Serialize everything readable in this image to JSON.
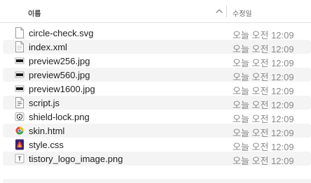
{
  "header": {
    "name_label": "이름",
    "date_label": "수정일"
  },
  "files": [
    {
      "name": "circle-check.svg",
      "date": "오늘 오전 12:09",
      "icon": "svg-file-icon"
    },
    {
      "name": "index.xml",
      "date": "오늘 오전 12:09",
      "icon": "text-file-icon"
    },
    {
      "name": "preview256.jpg",
      "date": "오늘 오전 12:09",
      "icon": "image-file-icon"
    },
    {
      "name": "preview560.jpg",
      "date": "오늘 오전 12:09",
      "icon": "image-file-icon"
    },
    {
      "name": "preview1600.jpg",
      "date": "오늘 오전 12:09",
      "icon": "image-file-icon"
    },
    {
      "name": "script.js",
      "date": "오늘 오전 12:09",
      "icon": "script-file-icon"
    },
    {
      "name": "shield-lock.png",
      "date": "오늘 오전 12:09",
      "icon": "shield-image-icon"
    },
    {
      "name": "skin.html",
      "date": "오늘 오전 12:09",
      "icon": "html-file-icon"
    },
    {
      "name": "style.css",
      "date": "오늘 오전 12:09",
      "icon": "css-file-icon"
    },
    {
      "name": "tistory_logo_image.png",
      "date": "오늘 오전 12:09",
      "icon": "png-file-icon"
    }
  ]
}
